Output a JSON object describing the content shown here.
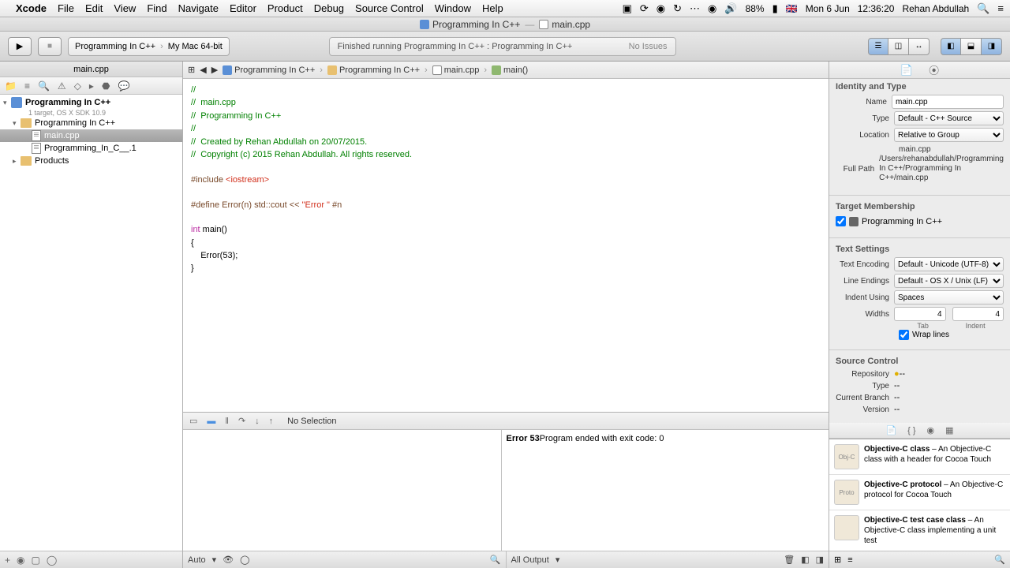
{
  "menubar": {
    "app": "Xcode",
    "items": [
      "File",
      "Edit",
      "View",
      "Find",
      "Navigate",
      "Editor",
      "Product",
      "Debug",
      "Source Control",
      "Window",
      "Help"
    ],
    "battery": "88%",
    "flag": "🇬🇧",
    "date": "Mon 6 Jun",
    "time": "12:36:20",
    "user": "Rehan Abdullah"
  },
  "window": {
    "title_left": "Programming In C++",
    "title_right": "main.cpp"
  },
  "toolbar": {
    "scheme_target": "Programming In C++",
    "scheme_dest": "My Mac 64-bit",
    "activity": "Finished running Programming In C++ : Programming In C++",
    "no_issues": "No Issues"
  },
  "navigator": {
    "open_tab": "main.cpp",
    "project": "Programming In C++",
    "project_sub": "1 target, OS X SDK 10.9",
    "group": "Programming In C++",
    "files": [
      "main.cpp",
      "Programming_In_C__.1"
    ],
    "products": "Products"
  },
  "jumpbar": {
    "p1": "Programming In C++",
    "p2": "Programming In C++",
    "p3": "main.cpp",
    "p4": "main()"
  },
  "code": {
    "c1": "//",
    "c2": "//  main.cpp",
    "c3": "//  Programming In C++",
    "c4": "//",
    "c5": "//  Created by Rehan Abdullah on 20/07/2015.",
    "c6": "//  Copyright (c) 2015 Rehan Abdullah. All rights reserved.",
    "include_pre": "#include ",
    "include_path": "<iostream>",
    "define": "#define Error(n) std::cout << ",
    "define_str": "\"Error \"",
    "define_tail": " #n",
    "kw_int": "int",
    "main_sig": " main()",
    "brace_open": "{",
    "body": "    Error(53);",
    "brace_close": "}"
  },
  "debug": {
    "nosel": "No Selection",
    "console_bold": "Error 53",
    "console_rest": "Program ended with exit code: 0",
    "auto": "Auto",
    "all_output": "All Output"
  },
  "inspector": {
    "identity_title": "Identity and Type",
    "name_label": "Name",
    "name_value": "main.cpp",
    "type_label": "Type",
    "type_value": "Default - C++ Source",
    "location_label": "Location",
    "location_value": "Relative to Group",
    "rel_file": "main.cpp",
    "fullpath_label": "Full Path",
    "fullpath_value": "/Users/rehanabdullah/Programming In C++/Programming In C++/main.cpp",
    "target_title": "Target Membership",
    "target_name": "Programming In C++",
    "text_title": "Text Settings",
    "enc_label": "Text Encoding",
    "enc_value": "Default - Unicode (UTF-8)",
    "endings_label": "Line Endings",
    "endings_value": "Default - OS X / Unix (LF)",
    "indent_label": "Indent Using",
    "indent_value": "Spaces",
    "widths_label": "Widths",
    "tab_width": "4",
    "indent_width": "4",
    "tab_sub": "Tab",
    "indent_sub": "Indent",
    "wrap": "Wrap lines",
    "sc_title": "Source Control",
    "repo_label": "Repository",
    "repo_value": "--",
    "sc_type_label": "Type",
    "sc_type_value": "--",
    "branch_label": "Current Branch",
    "branch_value": "--",
    "version_label": "Version",
    "version_value": "--",
    "lib": [
      {
        "name": "Objective-C class",
        "desc": " – An Objective-C class with a header for Cocoa Touch",
        "thumb": "Obj-C"
      },
      {
        "name": "Objective-C protocol",
        "desc": " – An Objective-C protocol for Cocoa Touch",
        "thumb": "Proto"
      },
      {
        "name": "Objective-C test case class",
        "desc": " – An Objective-C class implementing a unit test",
        "thumb": ""
      }
    ]
  }
}
